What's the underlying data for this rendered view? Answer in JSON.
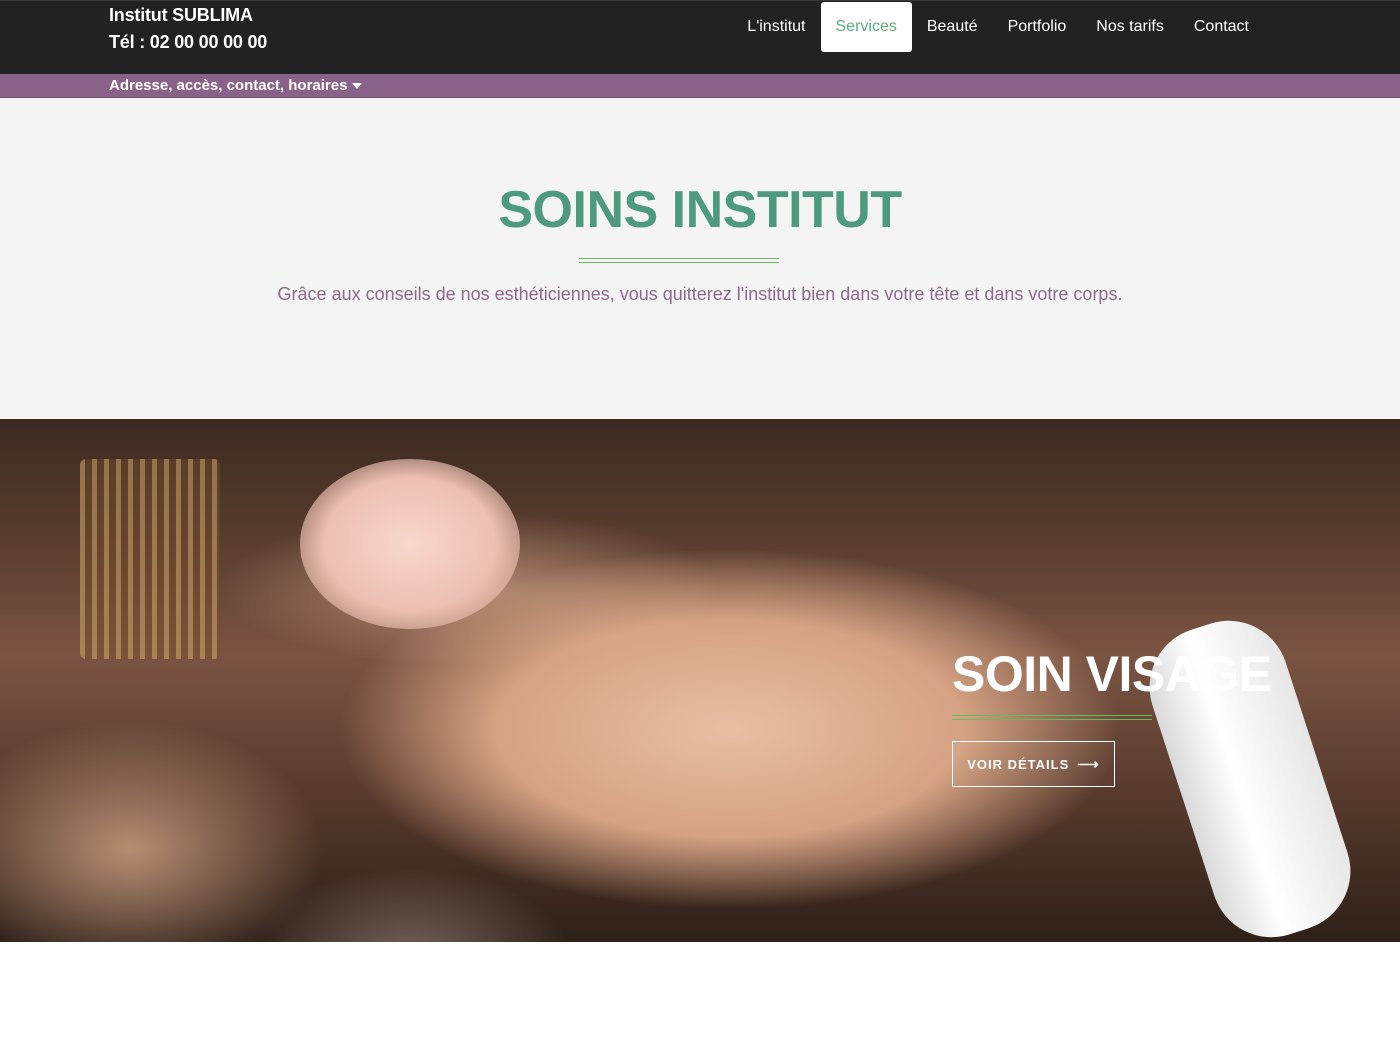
{
  "header": {
    "brand_name": "Institut SUBLIMA",
    "phone": "Tél : 02 00 00 00 00"
  },
  "nav": {
    "items": [
      {
        "label": "L'institut",
        "active": false
      },
      {
        "label": "Services",
        "active": true
      },
      {
        "label": "Beauté",
        "active": false
      },
      {
        "label": "Portfolio",
        "active": false
      },
      {
        "label": "Nos tarifs",
        "active": false
      },
      {
        "label": "Contact",
        "active": false
      }
    ]
  },
  "infobar": {
    "label": "Adresse, accès, contact, horaires",
    "icon": "caret-down-icon"
  },
  "intro": {
    "title": "SOINS INSTITUT",
    "text": "Grâce aux conseils de nos esthéticiennes, vous quitterez l'institut bien dans votre tête et dans votre corps."
  },
  "hero": {
    "title": "SOIN VISAGE",
    "button_label": "VOIR DÉTAILS",
    "button_icon": "arrow-right-icon"
  },
  "colors": {
    "topbar": "#222222",
    "infobar": "#8a6289",
    "accent_green": "#4e9a7e",
    "nav_active": "#5ab077",
    "intro_text": "#8d6a8c"
  }
}
